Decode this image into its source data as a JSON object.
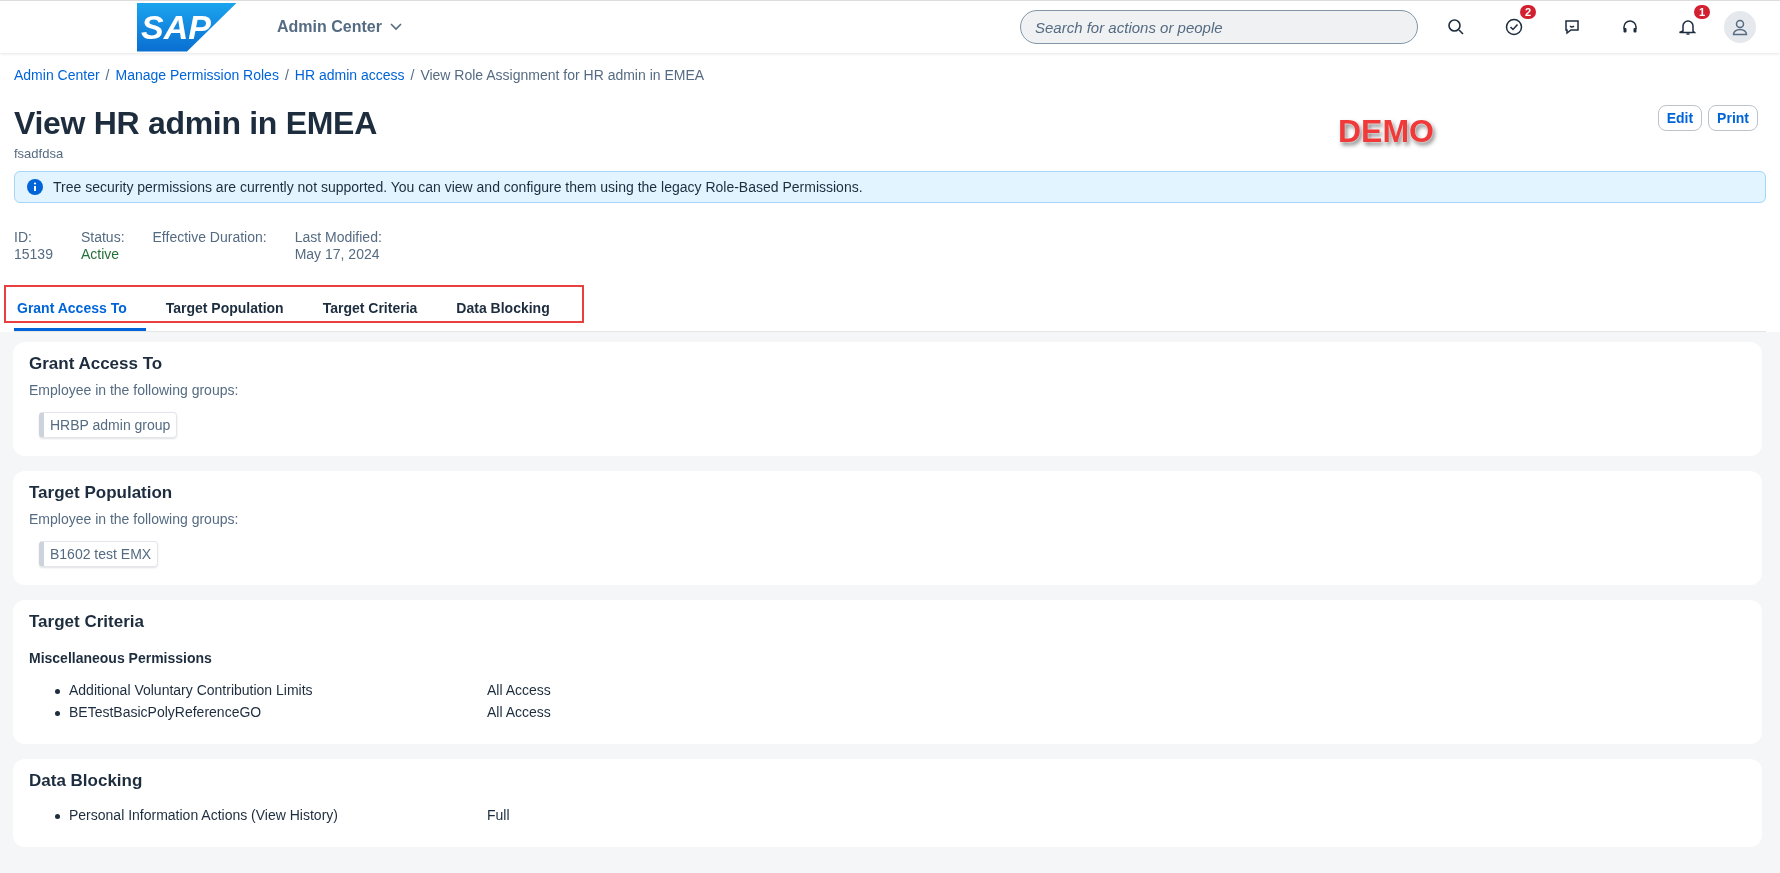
{
  "shell": {
    "logo": "SAP",
    "product": "Admin Center",
    "search": {
      "placeholder": "Search for actions or people"
    },
    "badges": {
      "tasks": "2",
      "notifications": "1"
    }
  },
  "breadcrumbs": [
    {
      "label": "Admin Center",
      "link": true
    },
    {
      "separator": "/",
      "label": "Manage Permission Roles",
      "link": true
    },
    {
      "separator": "/",
      "label": "HR admin access",
      "link": true
    },
    {
      "separator": "/",
      "label": "View Role Assignment for HR admin in EMEA",
      "link": false
    }
  ],
  "title": "View HR admin in EMEA",
  "subtitle": "fsadfdsa",
  "actions": [
    "Edit",
    "Print"
  ],
  "annotation": "DEMO",
  "info": "Tree security permissions are currently not supported. You can view and configure them using the legacy Role-Based Permissions.",
  "attributes": [
    {
      "label": "ID:",
      "value": "15139",
      "kind": "plain"
    },
    {
      "label": "Status:",
      "value": "Active",
      "kind": "positive"
    },
    {
      "label": "Effective Duration:"
    },
    {
      "label": "Last Modified:",
      "value": "May 17, 2024",
      "kind": "plain"
    }
  ],
  "tabs": [
    {
      "label": "Grant Access To",
      "selected": true
    },
    {
      "label": "Target Population",
      "selected": false
    },
    {
      "label": "Target Criteria",
      "selected": false
    },
    {
      "label": "Data Blocking",
      "selected": false
    }
  ],
  "sections": [
    {
      "title": "Grant Access To",
      "kind": "groups",
      "intro": "Employee in the following groups:",
      "groups": [
        "HRBP admin group"
      ]
    },
    {
      "title": "Target Population",
      "kind": "groups",
      "intro": "Employee in the following groups:",
      "groups": [
        "B1602 test EMX"
      ]
    },
    {
      "title": "Target Criteria",
      "kind": "permissions",
      "heading": "Miscellaneous Permissions",
      "items": [
        {
          "name": "Additional Voluntary Contribution Limits",
          "access": "All Access"
        },
        {
          "name": "BETestBasicPolyReferenceGO",
          "access": "All Access"
        }
      ]
    },
    {
      "title": "Data Blocking",
      "kind": "permissions",
      "items": [
        {
          "name": "Personal Information Actions (View History)",
          "access": "Full"
        }
      ]
    }
  ]
}
